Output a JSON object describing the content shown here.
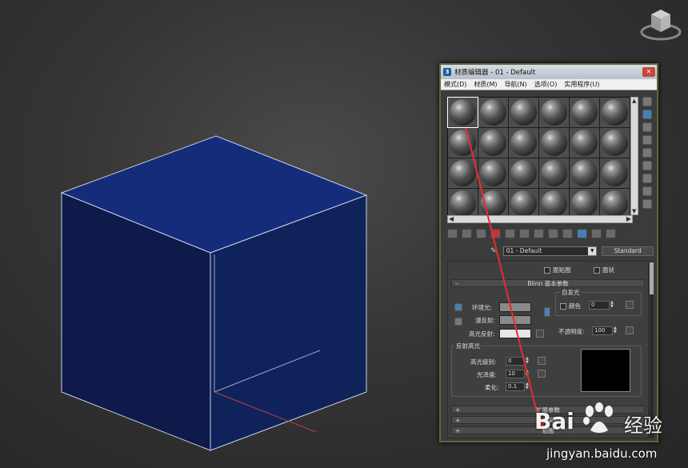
{
  "window": {
    "title": "材质编辑器 - 01 - Default",
    "close_glyph": "✕"
  },
  "menu": {
    "items": [
      "模式(D)",
      "材质(M)",
      "导航(N)",
      "选项(O)",
      "实用程序(U)"
    ]
  },
  "slots": {
    "rows": 4,
    "cols": 6,
    "active_index": 0
  },
  "material": {
    "name": "01 - Default",
    "type": "Standard"
  },
  "rollouts": {
    "face_map_label": "面贴图",
    "faceted_label": "面状",
    "blinn_title": "Blinn 基本参数",
    "self_illum_title": "自发光",
    "color_label": "颜色",
    "self_illum_value": "0",
    "ambient_label": "环境光:",
    "diffuse_label": "漫反射:",
    "specular_label": "高光反射:",
    "opacity_label": "不透明度:",
    "opacity_value": "100",
    "spec_highlight_title": "反射高光",
    "spec_level_label": "高光级别:",
    "spec_level_value": "0",
    "glossiness_label": "光泽度:",
    "glossiness_value": "10",
    "soften_label": "柔化:",
    "soften_value": "0.1",
    "extended_title": "扩展参数",
    "supersampling_title": "超级采样",
    "maps_title": "贴图"
  },
  "colors": {
    "cube_front": "#0d1a4a",
    "cube_side": "#10225a",
    "cube_top": "#142c7a",
    "cube_edge": "#c8d0e8",
    "ambient_swatch": "#8a8a8a",
    "diffuse_swatch": "#8a8a8a",
    "specular_swatch": "#e6e6e6",
    "annotation_arrow": "#e03030"
  },
  "watermark": {
    "brand": "Bai",
    "product": "经验",
    "url": "jingyan.baidu.com"
  }
}
